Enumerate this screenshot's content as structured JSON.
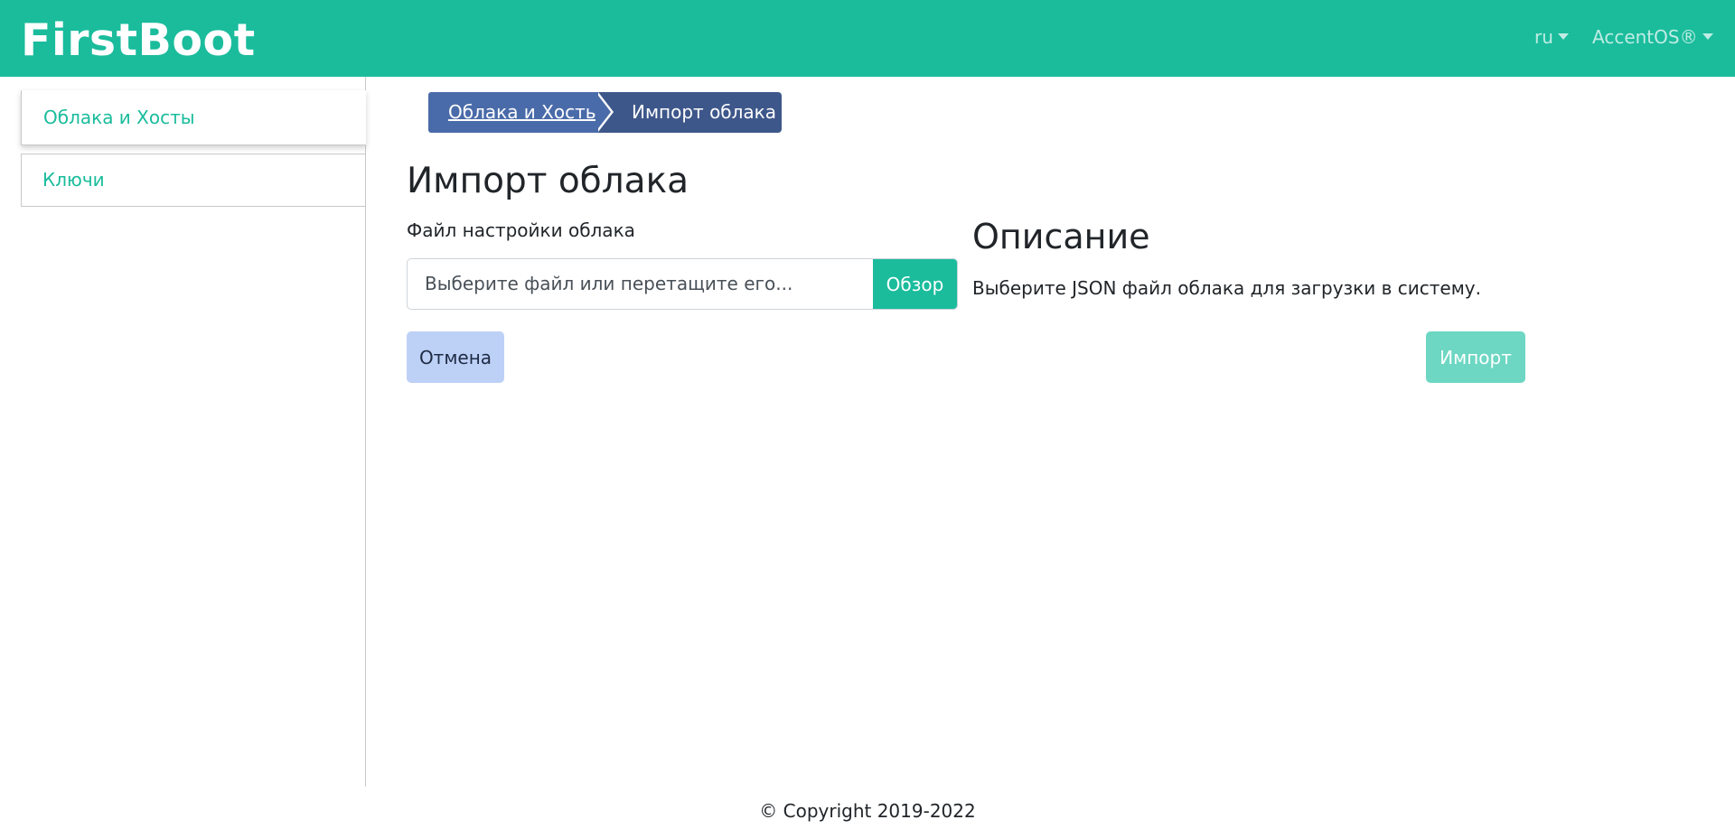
{
  "app": {
    "brand": "FirstBoot"
  },
  "navbar": {
    "language": "ru",
    "platform": "AccentOS®"
  },
  "sidebar": {
    "items": [
      {
        "label": "Облака и Хосты",
        "active": true
      },
      {
        "label": "Ключи",
        "active": false
      }
    ]
  },
  "breadcrumb": {
    "items": [
      {
        "label": "Облака и Хосты",
        "link": true
      },
      {
        "label": "Импорт облака",
        "link": false
      }
    ]
  },
  "page": {
    "title": "Импорт облака",
    "form": {
      "field_label": "Файл настройки облака",
      "file_placeholder": "Выберите файл или перетащите его...",
      "browse_label": "Обзор"
    },
    "description": {
      "title": "Описание",
      "text": "Выберите JSON файл облака для загрузки в систему."
    },
    "actions": {
      "cancel_label": "Отмена",
      "import_label": "Импорт"
    }
  },
  "footer": {
    "copyright": "© Copyright 2019-2022"
  },
  "colors": {
    "primary": "#1abc9c",
    "breadcrumb_link": "#4a6ba9",
    "breadcrumb_current": "#3e578a",
    "cancel_bg": "#bdd0f6",
    "import_disabled_bg": "#6dd7c3"
  }
}
